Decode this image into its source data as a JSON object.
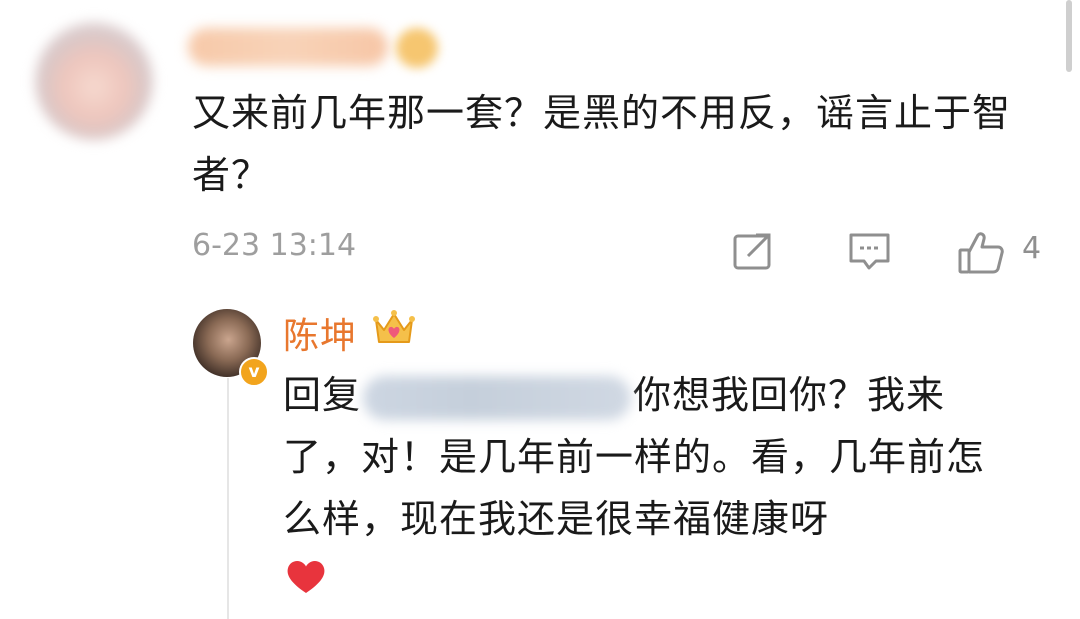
{
  "comment": {
    "text": "又来前几年那一套？是黑的不用反，谣言止于智者？",
    "time": "6-23 13:14",
    "like_count": "4"
  },
  "reply": {
    "author": "陈坤",
    "verified_mark": "v",
    "prefix": "回复",
    "text": "你想我回你？我来了，对！是几年前一样的。看，几年前怎么样，现在我还是很幸福健康呀"
  },
  "icons": [
    "share-icon",
    "comment-icon",
    "like-icon",
    "crown-icon",
    "heart-icon",
    "verified-icon"
  ],
  "colors": {
    "accent_name": "#e8772e",
    "icon_gray": "#8f8f8f",
    "time_gray": "#9e9e9e",
    "heart_red": "#e8343d"
  }
}
